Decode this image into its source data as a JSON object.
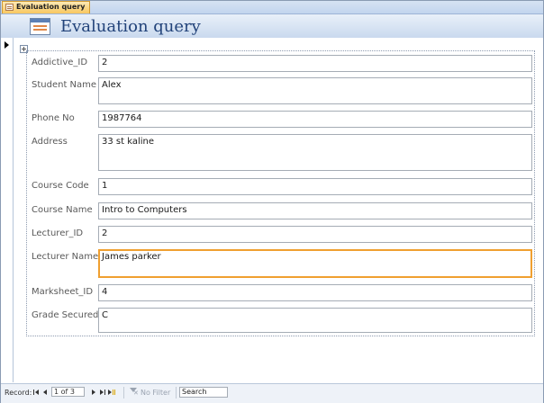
{
  "tab": {
    "title": "Evaluation query"
  },
  "header": {
    "title": "Evaluation query",
    "icon": "form-icon"
  },
  "fields": [
    {
      "label": "Addictive_ID",
      "value": "2"
    },
    {
      "label": "Student Name",
      "value": "Alex"
    },
    {
      "label": "Phone No",
      "value": "1987764"
    },
    {
      "label": "Address",
      "value": "33 st kaline"
    },
    {
      "label": "Course Code",
      "value": "1"
    },
    {
      "label": "Course Name",
      "value": "Intro to Computers"
    },
    {
      "label": "Lecturer_ID",
      "value": "2"
    },
    {
      "label": "Lecturer Name",
      "value": "James parker"
    },
    {
      "label": "Marksheet_ID",
      "value": "4"
    },
    {
      "label": "Grade Secured",
      "value": "C"
    }
  ],
  "navigation": {
    "record_label": "Record:",
    "current": "1 of 3",
    "no_filter": "No Filter",
    "search_placeholder": "Search"
  },
  "colors": {
    "focus_border": "#f0a030",
    "title": "#22437a",
    "tab": "#f8c75f"
  }
}
